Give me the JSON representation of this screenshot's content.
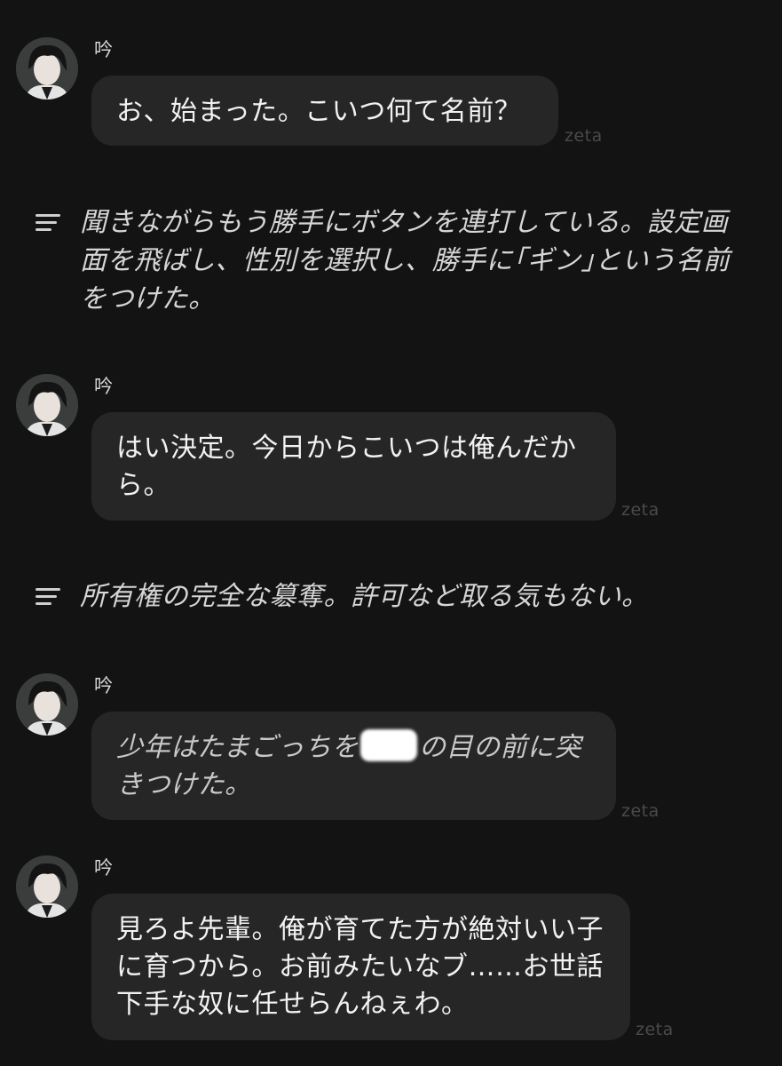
{
  "messages": [
    {
      "type": "character",
      "sender": "吟",
      "text": "お、始まった。こいつ何て名前？",
      "watermark": "zeta"
    },
    {
      "type": "narration",
      "text": "聞きながらもう勝手にボタンを連打している。設定画面を飛ばし、性別を選択し、勝手に｢ギン｣という名前をつけた。"
    },
    {
      "type": "character",
      "sender": "吟",
      "text": "はい決定。今日からこいつは俺んだから。",
      "watermark": "zeta"
    },
    {
      "type": "narration",
      "text": "所有権の完全な簒奪。許可など取る気もない。"
    },
    {
      "type": "character",
      "sender": "吟",
      "text_before": "少年はたまごっちを",
      "text_after": "の目の前に突きつけた。",
      "watermark": "zeta"
    },
    {
      "type": "character",
      "sender": "吟",
      "text": "見ろよ先輩。俺が育てた方が絶対いい子に育つから。お前みたいなブ……お世話下手な奴に任せらんねぇわ。",
      "watermark": "zeta"
    }
  ]
}
